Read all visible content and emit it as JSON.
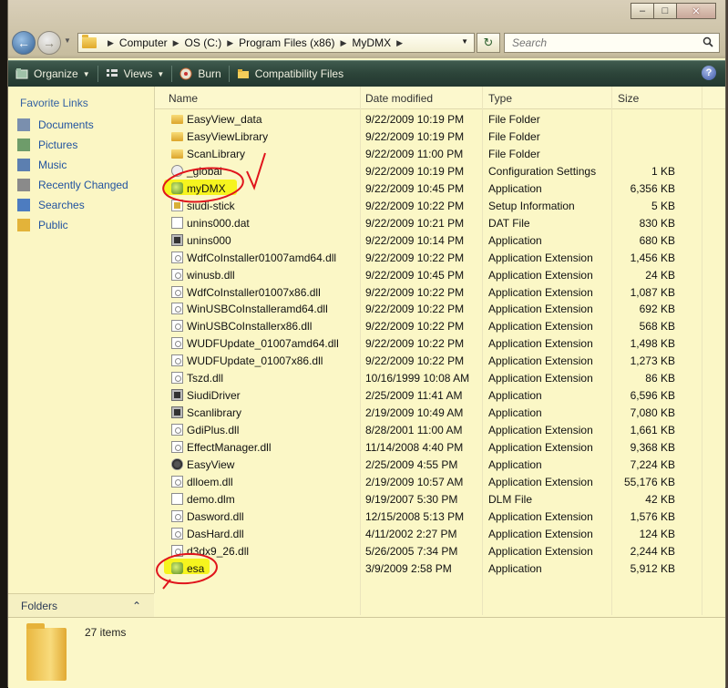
{
  "window": {
    "caption": {
      "minimize": "–",
      "maximize": "□",
      "close": "✕"
    }
  },
  "address": {
    "segments": [
      "Computer",
      "OS (C:)",
      "Program Files (x86)",
      "MyDMX"
    ],
    "search_placeholder": "Search"
  },
  "toolbar": {
    "organize": "Organize",
    "views": "Views",
    "burn": "Burn",
    "compat": "Compatibility Files",
    "help": "?"
  },
  "favorites": {
    "title": "Favorite Links",
    "items": [
      {
        "label": "Documents",
        "icon": "documents-icon"
      },
      {
        "label": "Pictures",
        "icon": "pictures-icon"
      },
      {
        "label": "Music",
        "icon": "music-icon"
      },
      {
        "label": "Recently Changed",
        "icon": "recently-changed-icon"
      },
      {
        "label": "Searches",
        "icon": "searches-icon"
      },
      {
        "label": "Public",
        "icon": "public-folder-icon"
      }
    ],
    "folders_label": "Folders"
  },
  "columns": {
    "name": "Name",
    "date": "Date modified",
    "type": "Type",
    "size": "Size"
  },
  "files": [
    {
      "name": "EasyView_data",
      "date": "9/22/2009 10:19 PM",
      "type": "File Folder",
      "size": "",
      "icon": "folder"
    },
    {
      "name": "EasyViewLibrary",
      "date": "9/22/2009 10:19 PM",
      "type": "File Folder",
      "size": "",
      "icon": "folder"
    },
    {
      "name": "ScanLibrary",
      "date": "9/22/2009 11:00 PM",
      "type": "File Folder",
      "size": "",
      "icon": "folder"
    },
    {
      "name": "_global",
      "date": "9/22/2009 10:19 PM",
      "type": "Configuration Settings",
      "size": "1 KB",
      "icon": "cfg"
    },
    {
      "name": "myDMX",
      "date": "9/22/2009 10:45 PM",
      "type": "Application",
      "size": "6,356 KB",
      "icon": "dmx"
    },
    {
      "name": "siudi-stick",
      "date": "9/22/2009 10:22 PM",
      "type": "Setup Information",
      "size": "5 KB",
      "icon": "setup"
    },
    {
      "name": "unins000.dat",
      "date": "9/22/2009 10:21 PM",
      "type": "DAT File",
      "size": "830 KB",
      "icon": "file"
    },
    {
      "name": "unins000",
      "date": "9/22/2009 10:14 PM",
      "type": "Application",
      "size": "680 KB",
      "icon": "app"
    },
    {
      "name": "WdfCoInstaller01007amd64.dll",
      "date": "9/22/2009 10:22 PM",
      "type": "Application Extension",
      "size": "1,456 KB",
      "icon": "dll"
    },
    {
      "name": "winusb.dll",
      "date": "9/22/2009 10:45 PM",
      "type": "Application Extension",
      "size": "24 KB",
      "icon": "dll"
    },
    {
      "name": "WdfCoInstaller01007x86.dll",
      "date": "9/22/2009 10:22 PM",
      "type": "Application Extension",
      "size": "1,087 KB",
      "icon": "dll"
    },
    {
      "name": "WinUSBCoInstalleramd64.dll",
      "date": "9/22/2009 10:22 PM",
      "type": "Application Extension",
      "size": "692 KB",
      "icon": "dll"
    },
    {
      "name": "WinUSBCoInstallerx86.dll",
      "date": "9/22/2009 10:22 PM",
      "type": "Application Extension",
      "size": "568 KB",
      "icon": "dll"
    },
    {
      "name": "WUDFUpdate_01007amd64.dll",
      "date": "9/22/2009 10:22 PM",
      "type": "Application Extension",
      "size": "1,498 KB",
      "icon": "dll"
    },
    {
      "name": "WUDFUpdate_01007x86.dll",
      "date": "9/22/2009 10:22 PM",
      "type": "Application Extension",
      "size": "1,273 KB",
      "icon": "dll"
    },
    {
      "name": "Tszd.dll",
      "date": "10/16/1999 10:08 AM",
      "type": "Application Extension",
      "size": "86 KB",
      "icon": "dll"
    },
    {
      "name": "SiudiDriver",
      "date": "2/25/2009 11:41 AM",
      "type": "Application",
      "size": "6,596 KB",
      "icon": "app"
    },
    {
      "name": "Scanlibrary",
      "date": "2/19/2009 10:49 AM",
      "type": "Application",
      "size": "7,080 KB",
      "icon": "app"
    },
    {
      "name": "GdiPlus.dll",
      "date": "8/28/2001 11:00 AM",
      "type": "Application Extension",
      "size": "1,661 KB",
      "icon": "dll"
    },
    {
      "name": "EffectManager.dll",
      "date": "11/14/2008 4:40 PM",
      "type": "Application Extension",
      "size": "9,368 KB",
      "icon": "dll"
    },
    {
      "name": "EasyView",
      "date": "2/25/2009 4:55 PM",
      "type": "Application",
      "size": "7,224 KB",
      "icon": "round"
    },
    {
      "name": "dlloem.dll",
      "date": "2/19/2009 10:57 AM",
      "type": "Application Extension",
      "size": "55,176 KB",
      "icon": "dll"
    },
    {
      "name": "demo.dlm",
      "date": "9/19/2007 5:30 PM",
      "type": "DLM File",
      "size": "42 KB",
      "icon": "file"
    },
    {
      "name": "Dasword.dll",
      "date": "12/15/2008 5:13 PM",
      "type": "Application Extension",
      "size": "1,576 KB",
      "icon": "dll"
    },
    {
      "name": "DasHard.dll",
      "date": "4/11/2002 2:27 PM",
      "type": "Application Extension",
      "size": "124 KB",
      "icon": "dll"
    },
    {
      "name": "d3dx9_26.dll",
      "date": "5/26/2005 7:34 PM",
      "type": "Application Extension",
      "size": "2,244 KB",
      "icon": "dll"
    },
    {
      "name": "esa",
      "date": "3/9/2009 2:58 PM",
      "type": "Application",
      "size": "5,912 KB",
      "icon": "dmx"
    }
  ],
  "details": {
    "item_count": "27 items"
  },
  "colors": {
    "highlight": "#f4f300",
    "annotation": "#e0141c",
    "toolbar": "#2c4439",
    "link": "#2153a0"
  }
}
